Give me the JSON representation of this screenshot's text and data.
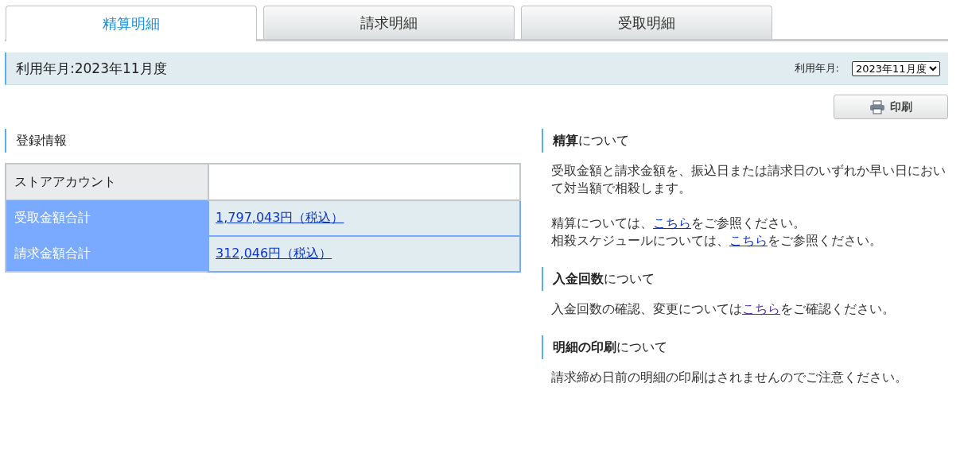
{
  "tabs": [
    {
      "label": "精算明細",
      "selected": true
    },
    {
      "label": "請求明細",
      "selected": false
    },
    {
      "label": "受取明細",
      "selected": false
    }
  ],
  "period_bar": {
    "title": "利用年月:2023年11月度",
    "select_label": "利用年月:",
    "select_value": "2023年11月度"
  },
  "print_button": {
    "label": "印刷"
  },
  "registration": {
    "heading": "登録情報",
    "rows": [
      {
        "label": "ストアアカウント",
        "value": "",
        "highlighted": false
      },
      {
        "label": "受取金額合計",
        "value": "1,797,043円（税込）",
        "highlighted": true
      },
      {
        "label": "請求金額合計",
        "value": "312,046円（税込）",
        "highlighted": true
      }
    ]
  },
  "info_sections": [
    {
      "heading": "**精算**について",
      "paragraphs": [
        [
          {
            "kind": "text",
            "text": "受取金額と請求金額を、振込日または請求日のいずれか早い日において対当額で相殺します。"
          }
        ],
        [
          {
            "kind": "text",
            "text": "精算については、"
          },
          {
            "kind": "link",
            "text": "こちら",
            "visited": false
          },
          {
            "kind": "text",
            "text": "をご参照ください。"
          }
        ],
        [
          {
            "kind": "text",
            "text": "相殺スケジュールについては、"
          },
          {
            "kind": "link",
            "text": "こちら",
            "visited": false
          },
          {
            "kind": "text",
            "text": "をご参照ください。"
          }
        ]
      ]
    },
    {
      "heading": "**入金回数**について",
      "paragraphs": [
        [
          {
            "kind": "text",
            "text": "入金回数の確認、変更については"
          },
          {
            "kind": "link",
            "text": "こちら",
            "visited": true
          },
          {
            "kind": "text",
            "text": "をご確認ください。"
          }
        ]
      ]
    },
    {
      "heading": "**明細の印刷**について",
      "paragraphs": [
        [
          {
            "kind": "text",
            "text": "請求締め日前の明細の印刷はされませんのでご注意ください。"
          }
        ]
      ]
    }
  ]
}
